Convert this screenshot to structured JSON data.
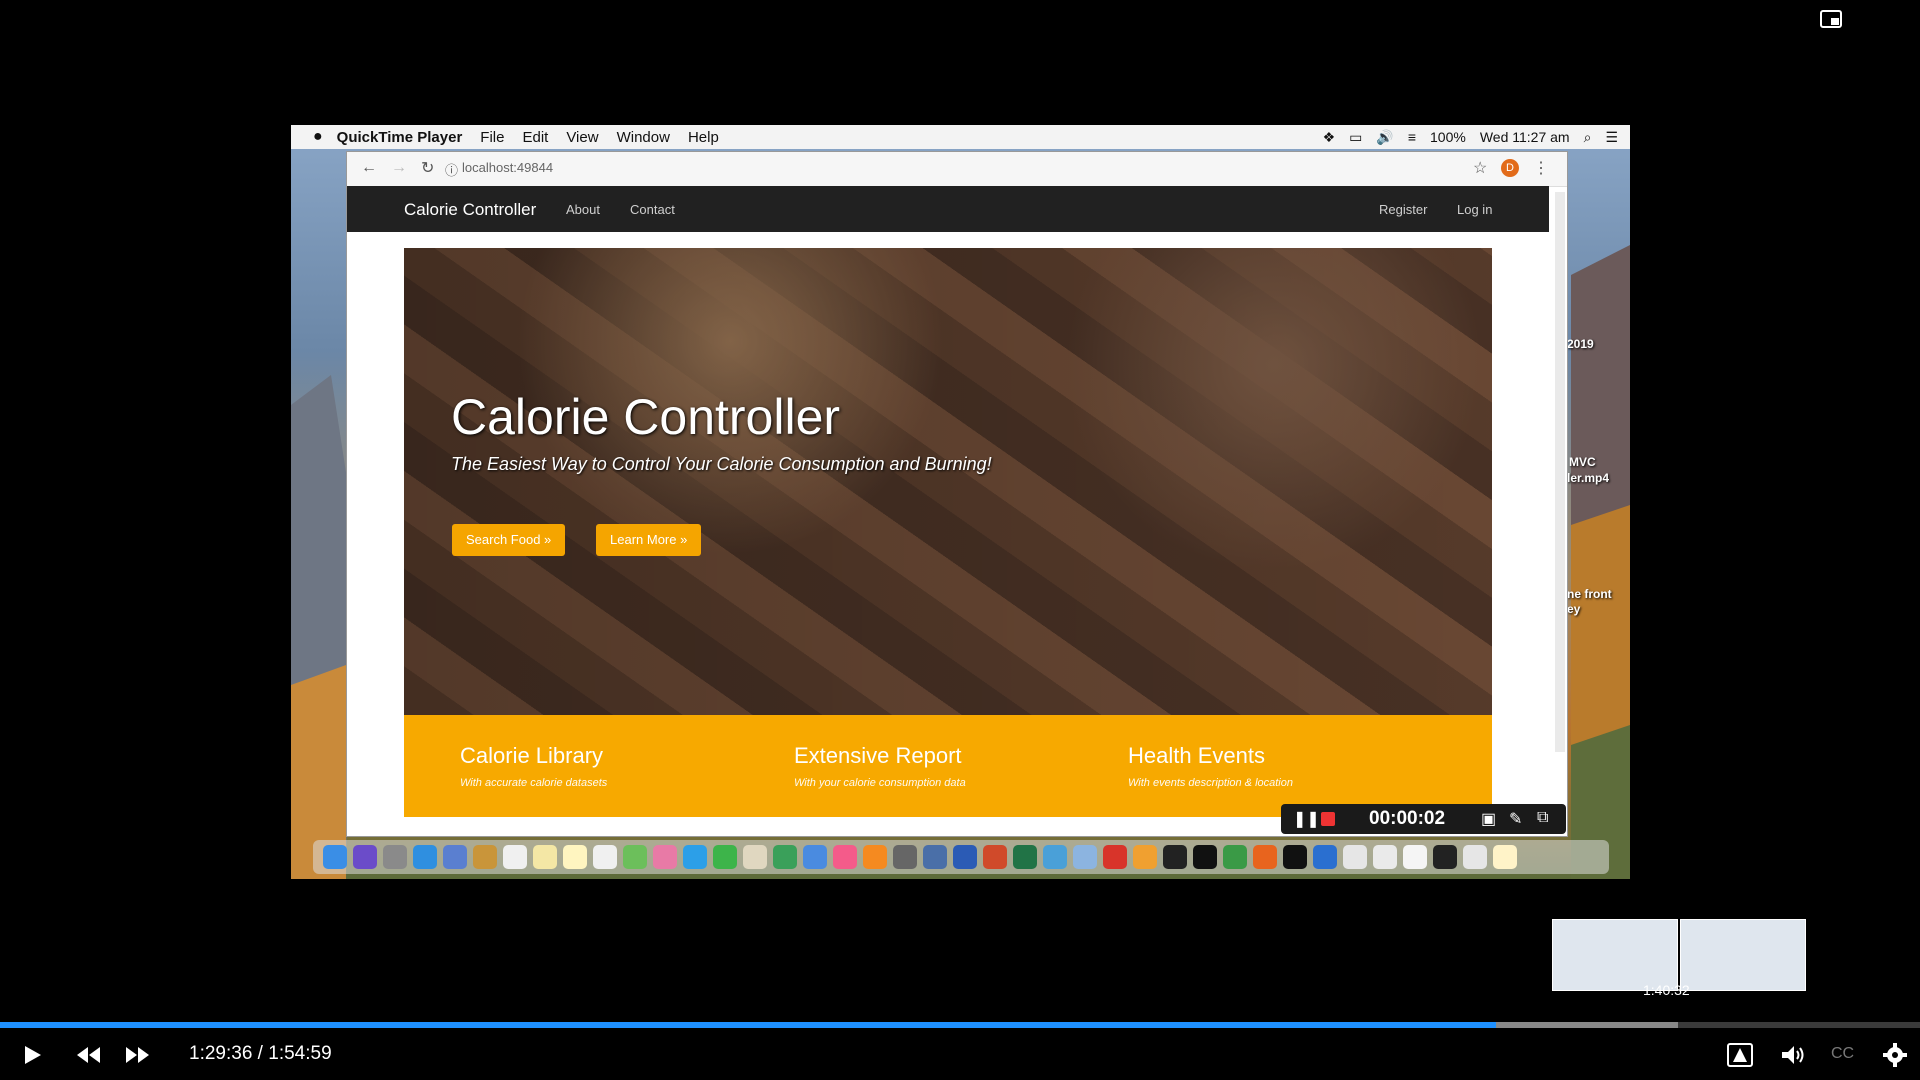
{
  "player": {
    "current_time": "1:29:36",
    "separator": " / ",
    "duration": "1:54:59",
    "preview_time": "1:40:32",
    "progress_fraction": 0.779,
    "hover_fraction": 0.874,
    "cc_label": "CC",
    "accent": "#1e90ff"
  },
  "macos": {
    "apple_icon": "apple-icon",
    "app_name": "QuickTime Player",
    "menus": [
      "File",
      "Edit",
      "View",
      "Window",
      "Help"
    ],
    "battery": "100%",
    "clock": "Wed 11:27 am"
  },
  "browser": {
    "address": "localhost:49844",
    "profile_initial": "D"
  },
  "site": {
    "brand": "Calorie Controller",
    "nav_left": [
      "About",
      "Contact"
    ],
    "nav_right": [
      "Register",
      "Log in"
    ],
    "hero_title": "Calorie Controller",
    "hero_subtitle": "The Easiest Way to Control Your Calorie Consumption and Burning!",
    "buttons": [
      "Search Food »",
      "Learn More »"
    ],
    "features": [
      {
        "title": "Calorie Library",
        "subtitle": "With accurate calorie datasets"
      },
      {
        "title": "Extensive Report",
        "subtitle": "With your calorie consumption data"
      },
      {
        "title": "Health Events",
        "subtitle": "With events description & location"
      }
    ],
    "accent": "#f7a900"
  },
  "recorder": {
    "timer": "00:00:02"
  },
  "desktop_labels": [
    "2019",
    "MVC",
    "ler.mp4",
    "ne front",
    "ey"
  ]
}
